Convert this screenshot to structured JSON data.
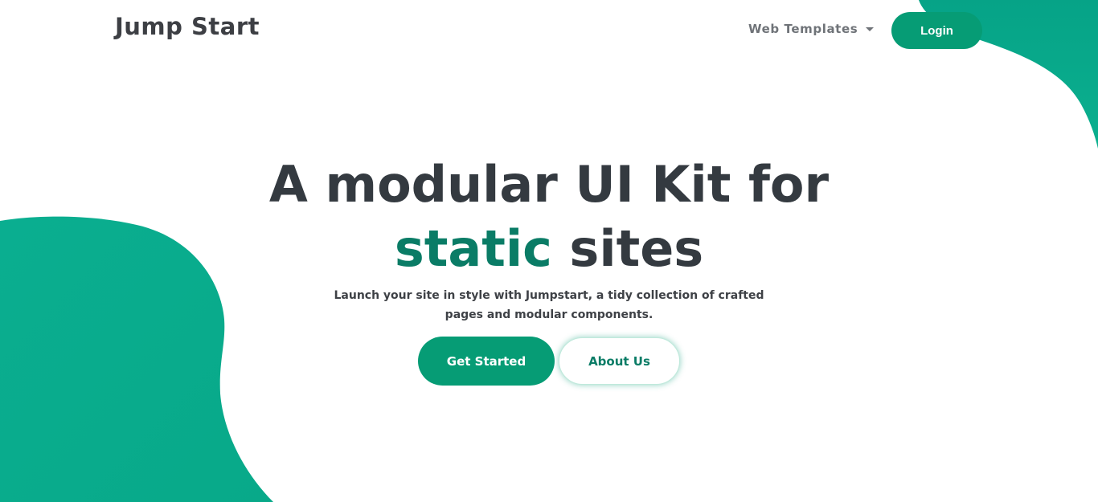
{
  "nav": {
    "brand": "Jump Start",
    "dropdown_label": "Web Templates",
    "login_label": "Login"
  },
  "hero": {
    "title_line1": "A modular UI Kit for",
    "title_accent": "static",
    "title_line2_rest": " sites",
    "subtitle_line1": "Launch your site in style with Jumpstart, a tidy collection of crafted",
    "subtitle_line2": "pages and modular components.",
    "primary_button": "Get Started",
    "secondary_button": "About Us"
  },
  "colors": {
    "brand_green": "#069c75",
    "accent_text": "#0a7c66",
    "heading": "#343a40"
  }
}
